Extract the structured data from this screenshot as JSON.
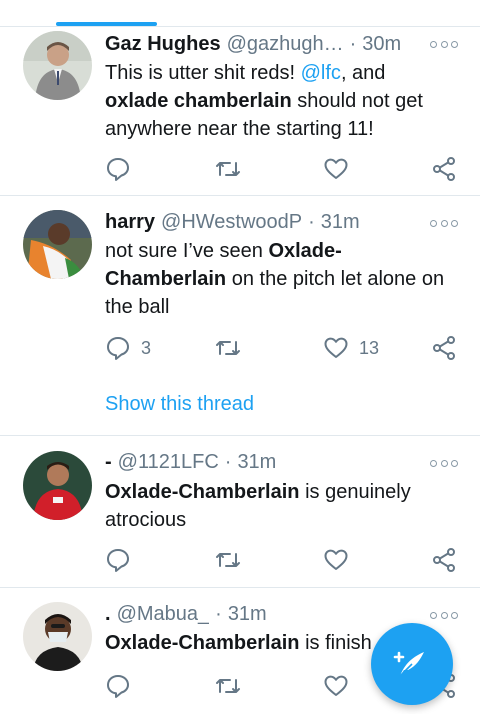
{
  "tweets": [
    {
      "name": "Gaz Hughes",
      "handle": "@gazhugh…",
      "time": "30m",
      "body": [
        {
          "text": "This is utter shit reds! ",
          "style": "plain"
        },
        {
          "text": "@lfc",
          "style": "mention"
        },
        {
          "text": ", and ",
          "style": "plain"
        },
        {
          "text": "oxlade chamberlain",
          "style": "bold"
        },
        {
          "text": " should not get anywhere near the starting 11!",
          "style": "plain"
        }
      ],
      "reply_count": "",
      "like_count": "",
      "avatar_icon": "avatar-man-suit"
    },
    {
      "name": "harry",
      "handle": "@HWestwoodP",
      "time": "31m",
      "body": [
        {
          "text": "not sure I’ve seen ",
          "style": "plain"
        },
        {
          "text": "Oxlade-Chamberlain",
          "style": "bold"
        },
        {
          "text": " on the pitch let alone on the ball",
          "style": "plain"
        }
      ],
      "reply_count": "3",
      "like_count": "13",
      "show_thread": "Show this thread",
      "avatar_icon": "avatar-man-flag"
    },
    {
      "name": "-",
      "handle": "@1121LFC",
      "time": "31m",
      "body": [
        {
          "text": "Oxlade-Chamberlain",
          "style": "bold"
        },
        {
          "text": " is genuinely atrocious",
          "style": "plain"
        }
      ],
      "reply_count": "",
      "like_count": "",
      "avatar_icon": "avatar-player-red-kit"
    },
    {
      "name": ".",
      "handle": "@Mabua_",
      "time": "31m",
      "body": [
        {
          "text": "Oxlade-Chamberlain",
          "style": "bold"
        },
        {
          "text": " is finish",
          "style": "plain"
        }
      ],
      "reply_count": "",
      "like_count": "",
      "avatar_icon": "avatar-man-mask"
    }
  ],
  "icons": {
    "reply": "reply-icon",
    "retweet": "retweet-icon",
    "like": "like-icon",
    "share": "share-icon",
    "more": "more-options-icon",
    "compose": "compose-tweet-icon"
  },
  "colors": {
    "accent": "#1da1f2",
    "text": "#14171a",
    "secondary": "#657786",
    "divider": "#e1e8ed"
  }
}
